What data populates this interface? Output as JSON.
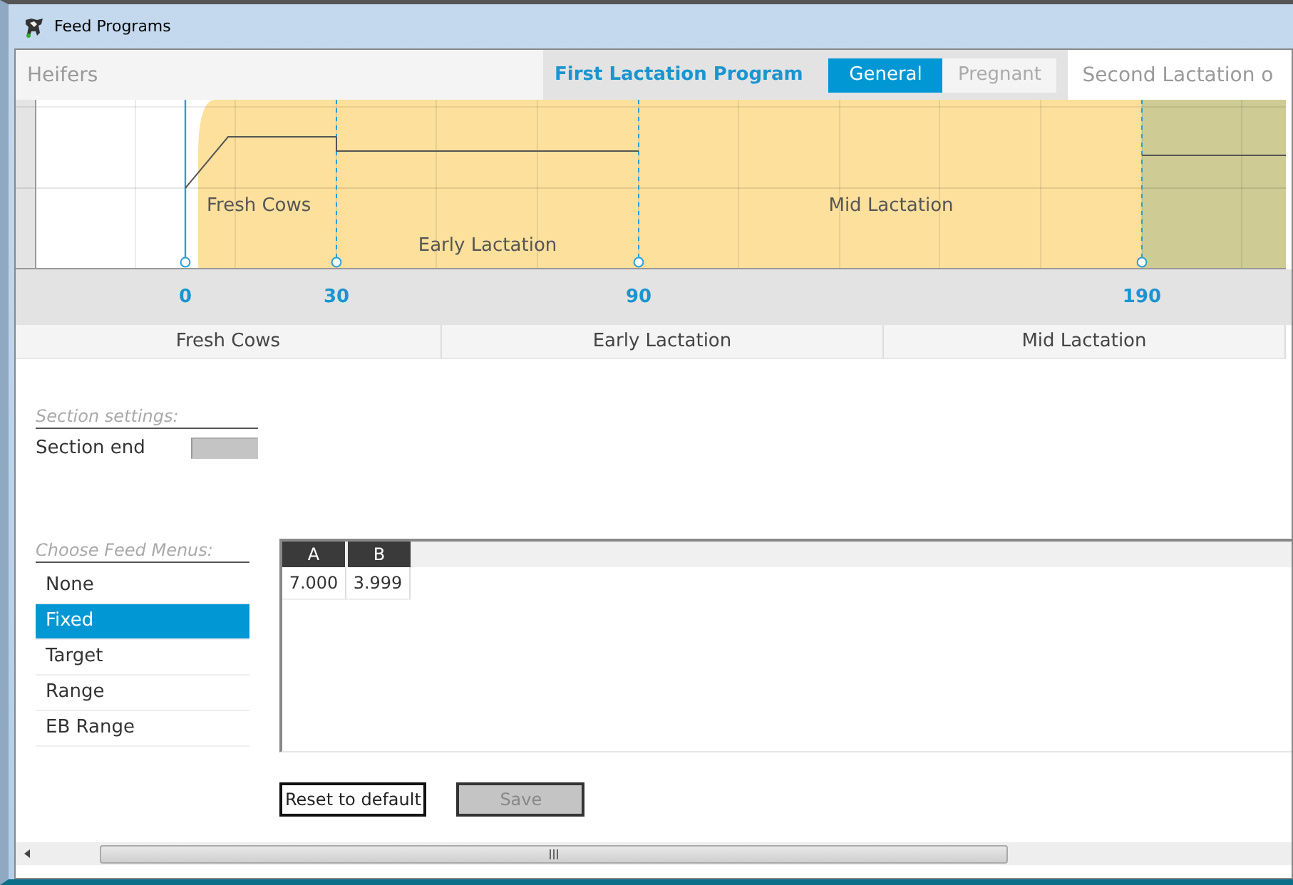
{
  "window": {
    "title": "Feed Programs"
  },
  "program_tabs": [
    {
      "label": "Heifers",
      "selected": false
    },
    {
      "label": "First Lactation Program",
      "selected": true
    },
    {
      "label": "Second Lactation o",
      "selected": false
    }
  ],
  "sub_tabs": [
    {
      "label": "General",
      "selected": true
    },
    {
      "label": "Pregnant",
      "selected": false
    }
  ],
  "timeline": {
    "section_labels": [
      "Fresh Cows",
      "Early Lactation",
      "Mid Lactation"
    ],
    "ticks": [
      "0",
      "30",
      "90",
      "190"
    ]
  },
  "section_headers": [
    {
      "label": "Fresh Cows",
      "selected": false
    },
    {
      "label": "Early Lactation",
      "selected": false
    },
    {
      "label": "Mid Lactation",
      "selected": false
    }
  ],
  "section_settings": {
    "heading": "Section settings:",
    "fields": [
      {
        "label": "Section end",
        "disabled": true
      }
    ]
  },
  "feed_menus": {
    "heading": "Choose Feed Menus:",
    "items": [
      {
        "label": "None",
        "selected": false
      },
      {
        "label": "Fixed",
        "selected": true
      },
      {
        "label": "Target",
        "selected": false
      },
      {
        "label": "Range",
        "selected": false
      },
      {
        "label": "EB Range",
        "selected": false
      }
    ]
  },
  "grid": {
    "columns": [
      "A",
      "B"
    ],
    "rows": [
      [
        "7.000",
        "3.999"
      ]
    ]
  },
  "buttons": [
    {
      "label": "Reset to default",
      "disabled": false
    },
    {
      "label": "Save",
      "disabled": true
    }
  ]
}
